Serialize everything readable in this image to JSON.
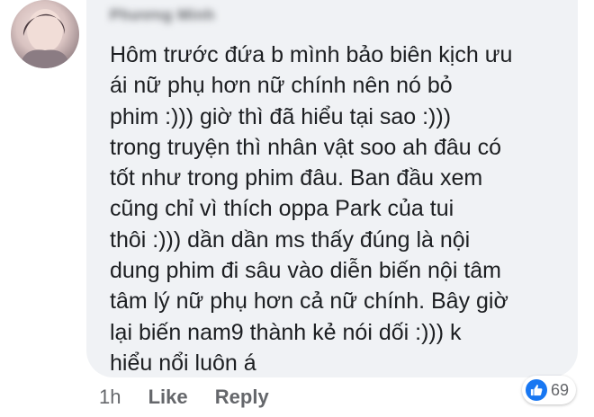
{
  "comment": {
    "author": "Phương Minh",
    "lines": [
      "Hôm trước đứa b mình bảo biên kịch ưu",
      "ái nữ phụ hơn nữ chính nên nó bỏ",
      "phim :))) giờ thì đã hiểu tại sao :)))",
      "trong truyện thì nhân vật soo ah đâu có",
      "tốt như trong phim đâu. Ban đầu xem",
      "cũng chỉ vì thích oppa Park của tui",
      "thôi :))) dần dần ms thấy đúng là nội",
      "dung phim đi sâu vào diễn biến nội tâm",
      "tâm lý nữ phụ hơn cả nữ chính. Bây giờ",
      "lại biến nam9 thành kẻ nói dối :))) k",
      "hiểu nổi luôn á"
    ]
  },
  "actions": {
    "time": "1h",
    "like_label": "Like",
    "reply_label": "Reply"
  },
  "reactions": {
    "icon": "like-thumb-icon",
    "count": "69",
    "color": "#1877f2"
  },
  "colors": {
    "bubble_bg": "#f0f2f5",
    "text": "#1c1e21",
    "muted": "#65676b"
  }
}
